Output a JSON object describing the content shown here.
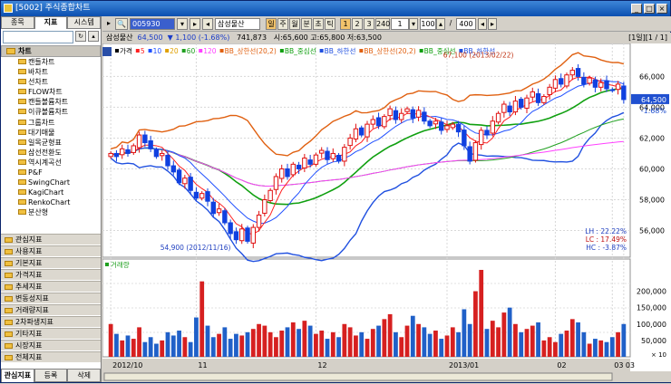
{
  "window": {
    "title": "[5002] 주식종합차트"
  },
  "left_panel": {
    "tabs": [
      "종목",
      "지표",
      "시스템"
    ],
    "header": "차트",
    "chart_items": [
      "캔들차트",
      "바차트",
      "선차트",
      "FLOW차트",
      "캔들볼륨차트",
      "이큐볼륨차트",
      "그룹차트",
      "대기매물",
      "일목균형표",
      "삼선전환도",
      "역시계곡선",
      "P&F",
      "SwingChart",
      "KagiChart",
      "RenkoChart",
      "분산형"
    ],
    "categories": [
      "관심지표",
      "사용지표",
      "기본지표",
      "가격지표",
      "추세지표",
      "변동성지표",
      "거래량지표",
      "2차파생지표",
      "기타지표",
      "시장지표",
      "전체지표"
    ],
    "bottom_tabs": [
      "관심지표",
      "등록",
      "삭제"
    ]
  },
  "toolbar": {
    "code": "005930",
    "name": "삼성물산",
    "periods": [
      "일",
      "주",
      "월",
      "분",
      "초",
      "틱"
    ],
    "numbers": [
      "1",
      "2",
      "3",
      "240"
    ],
    "count": "100",
    "total": "400"
  },
  "info": {
    "name": "삼성물산",
    "price": "64,500",
    "change": "▼ 1,100 (-1.68%)",
    "volume": "741,873",
    "ohlc": "시:65,600  고:65,800  저:63,500",
    "page": "[1일][1 / 1]"
  },
  "legend": {
    "items": [
      "가격",
      "5",
      "10",
      "20",
      "60",
      "120",
      "BB_상한선(20,2)",
      "BB_중심선",
      "BB_하한선",
      "BB_상한선(20,2)",
      "BB_중심선",
      "BB_하한선"
    ],
    "colors": [
      "#000000",
      "#ff2020",
      "#2050ff",
      "#e0a000",
      "#20a020",
      "#ff40ff",
      "#e06010",
      "#10a010",
      "#2050e0",
      "#e06010",
      "#10a010",
      "#2050e0"
    ]
  },
  "chart_data": {
    "type": "line",
    "price_axis": [
      "66,000",
      "64,000",
      "62,000",
      "60,000",
      "58,000",
      "56,000"
    ],
    "price_ylim": [
      54500,
      67200
    ],
    "current_price": "64,500",
    "current_change": "-1.68%",
    "high_note": "67,100 (2013/02/22)",
    "low_note": "54,900 (2012/11/16)",
    "stats": [
      "LH : 22.22%",
      "LC : 17.49%",
      "HC : -3.87%"
    ],
    "volume_label": "거래량",
    "volume_axis": [
      "200,000",
      "150,000",
      "100,000",
      "50,000",
      "× 10"
    ],
    "x_labels": [
      "2012/10",
      "11",
      "12",
      "2013/01",
      "02",
      "03",
      "03"
    ],
    "close": [
      61000,
      60800,
      61300,
      61000,
      61500,
      62200,
      61700,
      61300,
      60800,
      61000,
      60200,
      59800,
      59100,
      59400,
      58600,
      58100,
      58400,
      57900,
      57100,
      57400,
      56500,
      55800,
      55400,
      56100,
      55300,
      56200,
      57000,
      58000,
      58600,
      59500,
      60000,
      59500,
      60300,
      60000,
      60700,
      60300,
      60900,
      61200,
      60600,
      61000,
      60500,
      61400,
      62000,
      62600,
      62200,
      62900,
      63200,
      62800,
      63400,
      63900,
      63200,
      63600,
      63900,
      63300,
      63800,
      63100,
      62800,
      63100,
      62500,
      62800,
      62900,
      62400,
      61500,
      60500,
      61700,
      62500,
      62200,
      63100,
      63600,
      64200,
      63700,
      64400,
      64000,
      64600,
      65000,
      64300,
      64700,
      65300,
      65800,
      65500,
      66100,
      66400,
      66000,
      65500,
      65900,
      65300,
      65600,
      65200,
      65100,
      65500,
      64500
    ],
    "volume": [
      100,
      70,
      50,
      65,
      55,
      90,
      45,
      60,
      40,
      50,
      75,
      65,
      80,
      60,
      45,
      120,
      230,
      95,
      60,
      70,
      90,
      55,
      70,
      65,
      75,
      85,
      100,
      95,
      75,
      60,
      80,
      90,
      105,
      85,
      110,
      95,
      70,
      80,
      55,
      75,
      60,
      100,
      90,
      65,
      75,
      55,
      85,
      95,
      115,
      130,
      75,
      60,
      95,
      125,
      100,
      90,
      70,
      80,
      55,
      65,
      90,
      75,
      145,
      100,
      200,
      265,
      85,
      110,
      90,
      135,
      150,
      100,
      75,
      85,
      95,
      105,
      50,
      60,
      45,
      70,
      80,
      115,
      105,
      75,
      40,
      55,
      50,
      45,
      60,
      75,
      100
    ]
  }
}
